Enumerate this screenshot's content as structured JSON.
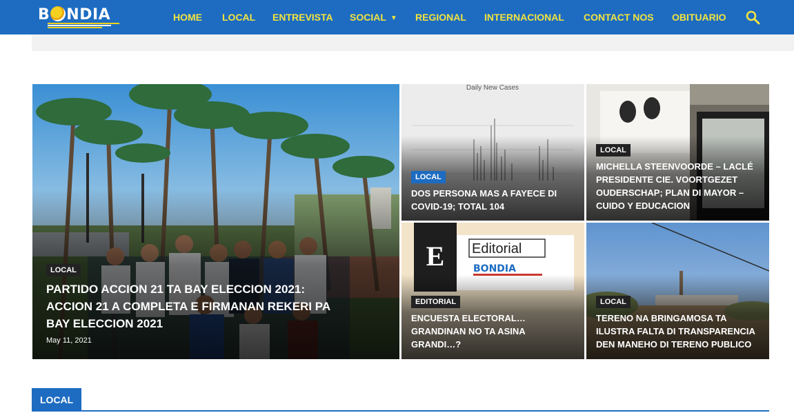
{
  "brand": {
    "logo_text_1": "B",
    "logo_text_2": "NDIA"
  },
  "nav": {
    "items": [
      {
        "label": "HOME"
      },
      {
        "label": "LOCAL"
      },
      {
        "label": "ENTREVISTA"
      },
      {
        "label": "SOCIAL"
      },
      {
        "label": "REGIONAL"
      },
      {
        "label": "INTERNACIONAL"
      },
      {
        "label": "CONTACT NOS"
      },
      {
        "label": "OBITUARIO"
      }
    ],
    "search_icon": "search-icon"
  },
  "featured": {
    "main": {
      "category": "LOCAL",
      "title": "PARTIDO ACCION 21 TA BAY ELECCION 2021: ACCION 21 A COMPLETA E FIRMANAN REKERI PA BAY ELECCION 2021",
      "date": "May 11, 2021"
    },
    "tiles": [
      {
        "category": "LOCAL",
        "title": "DOS PERSONA MAS A FAYECE DI COVID-19; TOTAL 104",
        "image_text": "Daily New Cases"
      },
      {
        "category": "LOCAL",
        "title": "MICHELLA STEENVOORDE – LACLÉ PRESIDENTE CIE. VOORTGEZET OUDERSCHAP; PLAN DI MAYOR – CUIDO Y EDUCACION"
      },
      {
        "category": "EDITORIAL",
        "title": "ENCUESTA ELECTORAL… GRANDINAN NO TA ASINA GRANDI…?",
        "image_text": "Editorial"
      },
      {
        "category": "LOCAL",
        "title": "TERENO NA BRINGAMOSA TA ILUSTRA FALTA DI TRANSPARENCIA DEN MANEHO DI TERENO PUBLICO"
      }
    ]
  },
  "section": {
    "title": "LOCAL"
  },
  "colors": {
    "brand_blue": "#1d6cc1",
    "nav_yellow": "#f3e33f"
  }
}
